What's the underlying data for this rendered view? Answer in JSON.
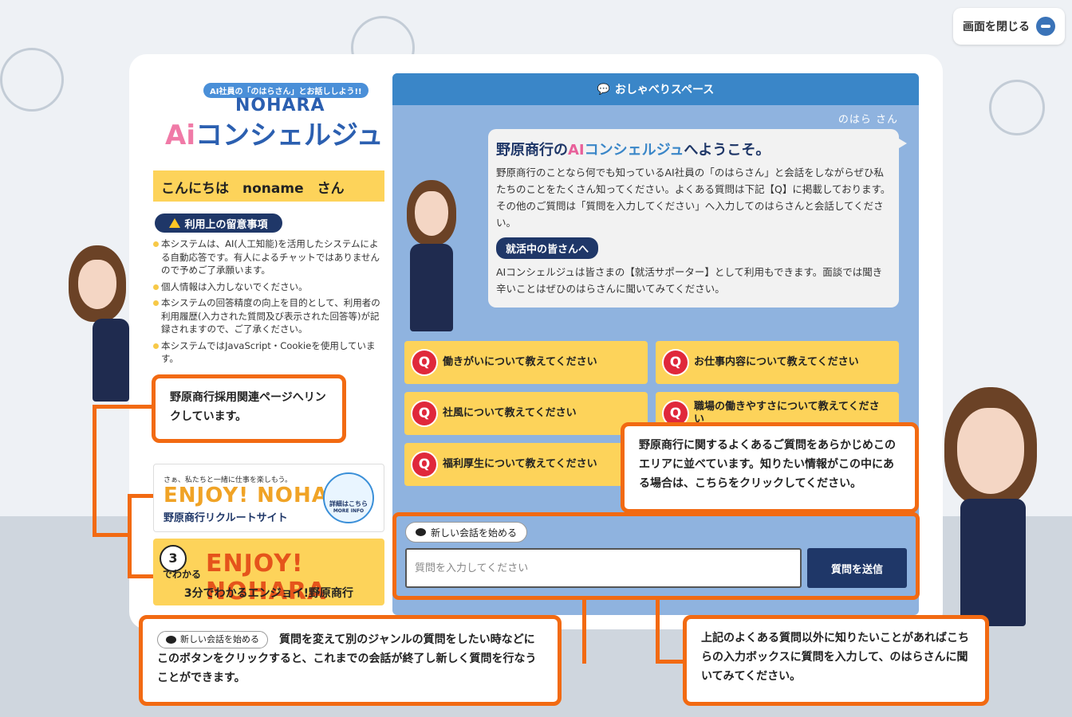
{
  "window": {
    "close_label": "画面を閉じる"
  },
  "logo": {
    "tagline": "AI社員の「のはらさん」とお話ししよう!!",
    "brand": "NOHARA",
    "ai": "Ai",
    "title": "コンシェルジュ"
  },
  "greeting": "こんにちは　noname　さん",
  "notice": {
    "title": "利用上の留意事項",
    "items": [
      "本システムは、AI(人工知能)を活用したシステムによる自動応答です。有人によるチャットではありませんので予めご了承願います。",
      "個人情報は入力しないでください。",
      "本システムの回答精度の向上を目的として、利用者の利用履歴(入力された質問及び表示された回答等)が記録されますので、ご了承ください。",
      "本システムではJavaScript・Cookieを使用しています。"
    ]
  },
  "banners": {
    "recruit": {
      "tagline": "さぁ、私たちと一緒に仕事を楽しもう。",
      "title": "ENJOY! NOHARA",
      "site": "野原商行リクルートサイト",
      "more": "詳細はこちら",
      "more_en": "MORE INFO"
    },
    "three_min": {
      "num": "3",
      "dewa": "でわかる",
      "title": "ENJOY! NOHARA",
      "caption": "3分でわかるエンジョイ!野原商行"
    }
  },
  "chat": {
    "header": "おしゃべりスペース",
    "speaker": "のはら さん",
    "welcome": {
      "pre": "野原商行の",
      "ai": "AI",
      "kon": "コンシェルジュ",
      "post": "へようこそ。"
    },
    "intro": "野原商行のことなら何でも知っているAI社員の「のはらさん」と会話をしながらぜひ私たちのことをたくさん知ってください。よくある質問は下記【Q】に掲載しております。その他のご質問は「質問を入力してください」へ入力してのはらさんと会話してください。",
    "sub_heading": "就活中の皆さんへ",
    "sub_text": "AIコンシェルジュは皆さまの【就活サポーター】として利用もできます。面談では聞き辛いことはぜひのはらさんに聞いてみてください。",
    "faq": [
      "働きがいについて教えてください",
      "お仕事内容について教えてください",
      "社風について教えてください",
      "職場の働きやすさについて教えてください",
      "福利厚生について教えてください"
    ],
    "faq_icon": "Q",
    "new_conversation": "新しい会話を始める",
    "input_placeholder": "質問を入力してください",
    "send_label": "質問を送信"
  },
  "callouts": {
    "links": "野原商行採用関連ページへリンクしています。",
    "faq": "野原商行に関するよくあるご質問をあらかじめこのエリアに並べています。知りたい情報がこの中にある場合は、こちらをクリックしてください。",
    "new_conv_chip": "新しい会話を始める",
    "new_conv": "質問を変えて別のジャンルの質問をしたい時などにこのボタンをクリックすると、これまでの会話が終了し新しく質問を行なうことができます。",
    "input": "上記のよくある質問以外に知りたいことがあればこちらの入力ボックスに質問を入力して、のはらさんに聞いてみてください。"
  },
  "colors": {
    "accent_orange": "#f26a12",
    "navy": "#1f3768",
    "yellow": "#fdd35a",
    "chat_bg": "#8fb3df",
    "header_blue": "#3a86c8"
  }
}
